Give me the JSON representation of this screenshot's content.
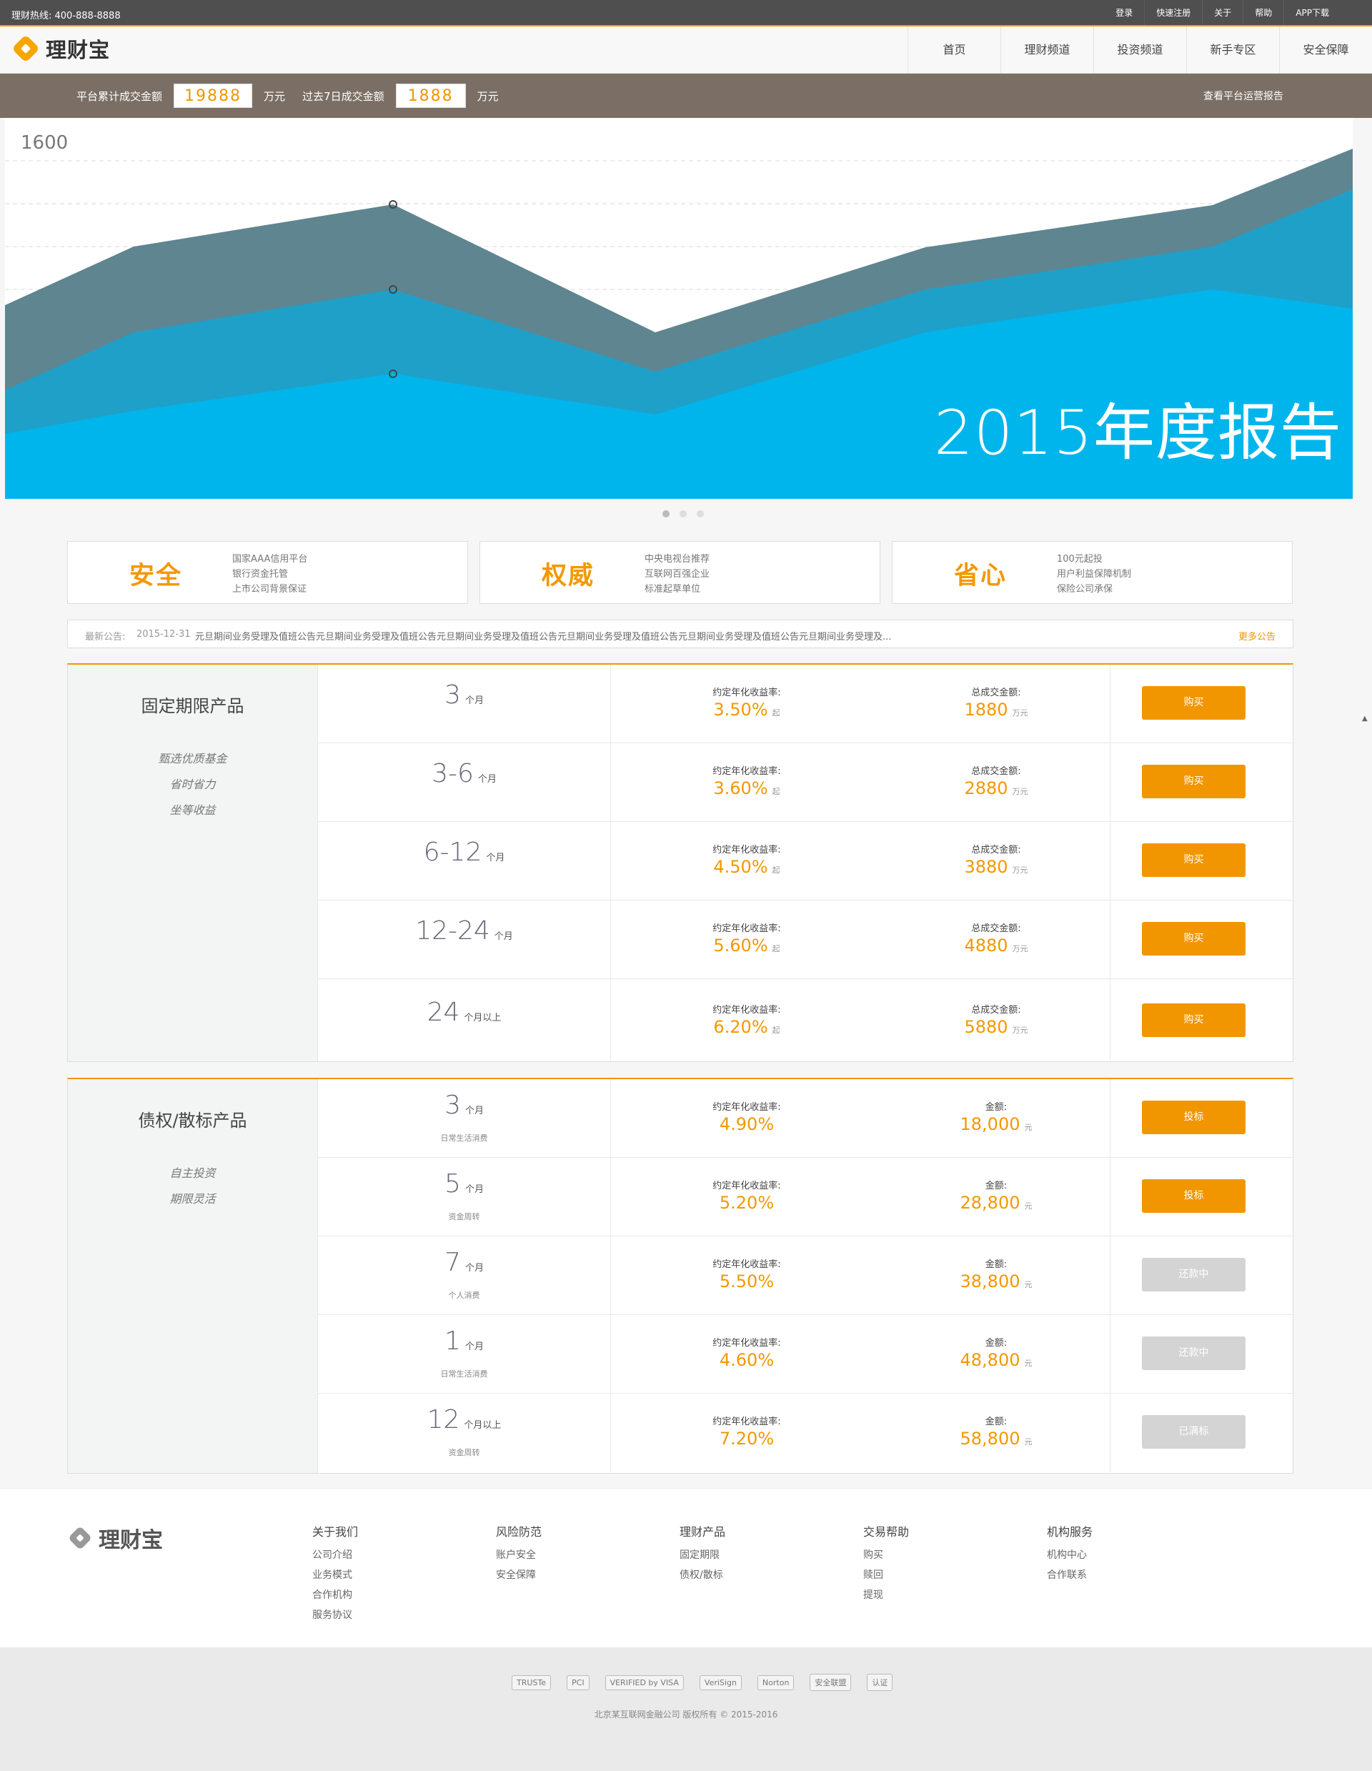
{
  "topbar": {
    "hotline": "理财热线: 400-888-8888",
    "links": [
      "登录",
      "快速注册",
      "关于",
      "帮助",
      "APP下载"
    ]
  },
  "header": {
    "logo": "理财宝",
    "nav": [
      "首页",
      "理财频道",
      "投资频道",
      "新手专区",
      "安全保障"
    ]
  },
  "stats": {
    "total_label": "平台累计成交金额",
    "total_value": "19888",
    "total_unit": "万元",
    "week_label": "过去7日成交金额",
    "week_value": "1888",
    "week_unit": "万元",
    "report_link": "查看平台运营报告"
  },
  "banner": {
    "title": "2015年度报告",
    "axis_label": "1600",
    "chart_colors": {
      "back": "#5f8590",
      "mid": "#1fa0c9",
      "front": "#00b5ec"
    }
  },
  "slider_dots": {
    "count": 3,
    "active": 0
  },
  "features": [
    {
      "title": "安全",
      "lines": [
        "国家AAA信用平台",
        "银行资金托管",
        "上市公司背景保证"
      ]
    },
    {
      "title": "权威",
      "lines": [
        "中央电视台推荐",
        "互联网百强企业",
        "标准起草单位"
      ]
    },
    {
      "title": "省心",
      "lines": [
        "100元起投",
        "用户利益保障机制",
        "保险公司承保"
      ]
    }
  ],
  "notice": {
    "label": "最新公告:",
    "date": "2015-12-31",
    "text": "元旦期间业务受理及值班公告元旦期间业务受理及值班公告元旦期间业务受理及值班公告元旦期间业务受理及值班公告元旦期间业务受理及值班公告元旦期间业务受理及...",
    "more": "更多公告"
  },
  "fixed": {
    "name": "固定期限产品",
    "tags": [
      "甄选优质基金",
      "省时省力",
      "坐等收益"
    ],
    "rate_label": "约定年化收益率:",
    "amount_label": "总成交金额:",
    "rows": [
      {
        "term": "3",
        "unit": "个月",
        "rate": "3.50%",
        "rate_sfx": "起",
        "amount": "1880",
        "amount_unit": "万元",
        "button": "购买"
      },
      {
        "term": "3-6",
        "unit": "个月",
        "rate": "3.60%",
        "rate_sfx": "起",
        "amount": "2880",
        "amount_unit": "万元",
        "button": "购买"
      },
      {
        "term": "6-12",
        "unit": "个月",
        "rate": "4.50%",
        "rate_sfx": "起",
        "amount": "3880",
        "amount_unit": "万元",
        "button": "购买"
      },
      {
        "term": "12-24",
        "unit": "个月",
        "rate": "5.60%",
        "rate_sfx": "起",
        "amount": "4880",
        "amount_unit": "万元",
        "button": "购买"
      },
      {
        "term": "24",
        "unit": "个月以上",
        "rate": "6.20%",
        "rate_sfx": "起",
        "amount": "5880",
        "amount_unit": "万元",
        "button": "购买"
      }
    ]
  },
  "debt": {
    "name": "债权/散标产品",
    "tags": [
      "自主投资",
      "期限灵活"
    ],
    "rate_label": "约定年化收益率:",
    "amount_label": "金额:",
    "rows": [
      {
        "term": "3",
        "unit": "个月",
        "sub": "日常生活消费",
        "rate": "4.90%",
        "amount": "18,000",
        "amount_unit": "元",
        "button": "投标",
        "state": "active"
      },
      {
        "term": "5",
        "unit": "个月",
        "sub": "资金周转",
        "rate": "5.20%",
        "amount": "28,800",
        "amount_unit": "元",
        "button": "投标",
        "state": "active"
      },
      {
        "term": "7",
        "unit": "个月",
        "sub": "个人消费",
        "rate": "5.50%",
        "amount": "38,800",
        "amount_unit": "元",
        "button": "还款中",
        "state": "disabled"
      },
      {
        "term": "1",
        "unit": "个月",
        "sub": "日常生活消费",
        "rate": "4.60%",
        "amount": "48,800",
        "amount_unit": "元",
        "button": "还款中",
        "state": "disabled"
      },
      {
        "term": "12",
        "unit": "个月以上",
        "sub": "资金周转",
        "rate": "7.20%",
        "amount": "58,800",
        "amount_unit": "元",
        "button": "已满标",
        "state": "disabled"
      }
    ]
  },
  "footer": {
    "logo": "理财宝",
    "columns": [
      {
        "title": "关于我们",
        "items": [
          "公司介绍",
          "业务模式",
          "合作机构",
          "服务协议"
        ]
      },
      {
        "title": "风险防范",
        "items": [
          "账户安全",
          "安全保障"
        ]
      },
      {
        "title": "理财产品",
        "items": [
          "固定期限",
          "债权/散标"
        ]
      },
      {
        "title": "交易帮助",
        "items": [
          "购买",
          "赎回",
          "提现"
        ]
      },
      {
        "title": "机构服务",
        "items": [
          "机构中心",
          "合作联系"
        ]
      }
    ],
    "badges": [
      "TRUSTe",
      "PCI",
      "VERIFIED by VISA",
      "VeriSign",
      "Norton",
      "安全联盟",
      "认证"
    ],
    "copyright": "北京某互联网金融公司 版权所有 © 2015-2016"
  }
}
